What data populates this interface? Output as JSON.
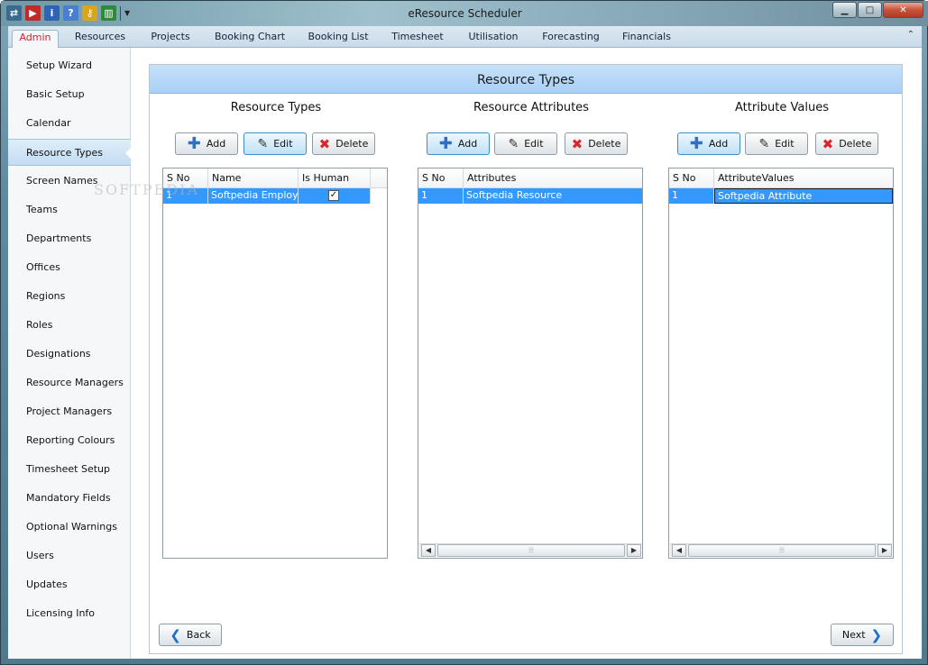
{
  "window": {
    "title": "eResource Scheduler"
  },
  "quick_access": {
    "icons": [
      "connect-icon",
      "exit-icon",
      "info-icon",
      "help-icon",
      "key-icon",
      "chart-icon"
    ]
  },
  "tabs": [
    {
      "label": "Admin",
      "active": true
    },
    {
      "label": "Resources"
    },
    {
      "label": "Projects"
    },
    {
      "label": "Booking Chart"
    },
    {
      "label": "Booking List"
    },
    {
      "label": "Timesheet"
    },
    {
      "label": "Utilisation"
    },
    {
      "label": "Forecasting"
    },
    {
      "label": "Financials"
    }
  ],
  "sidebar": {
    "active": "Resource Types",
    "items": [
      "Setup Wizard",
      "Basic Setup",
      "Calendar",
      "Resource Types",
      "Screen Names",
      "Teams",
      "Departments",
      "Offices",
      "Regions",
      "Roles",
      "Designations",
      "Resource Managers",
      "Project Managers",
      "Reporting Colours",
      "Timesheet Setup",
      "Mandatory Fields",
      "Optional Warnings",
      "Users",
      "Updates",
      "Licensing Info"
    ]
  },
  "panel": {
    "title": "Resource Types"
  },
  "buttons": {
    "add": "Add",
    "edit": "Edit",
    "delete": "Delete",
    "back": "Back",
    "next": "Next"
  },
  "sections": {
    "types": {
      "title": "Resource Types",
      "columns": [
        "S No",
        "Name",
        "Is Human"
      ],
      "rows": [
        {
          "sno": "1",
          "name": "Softpedia Employee",
          "is_human": true
        }
      ]
    },
    "attributes": {
      "title": "Resource Attributes",
      "columns": [
        "S No",
        "Attributes"
      ],
      "rows": [
        {
          "sno": "1",
          "value": "Softpedia Resource"
        }
      ]
    },
    "values": {
      "title": "Attribute Values",
      "columns": [
        "S No",
        "AttributeValues"
      ],
      "rows": [
        {
          "sno": "1",
          "value": "Softpedia Attribute"
        }
      ]
    }
  },
  "watermark": {
    "text": "SOFTPEDIA"
  },
  "colors": {
    "accent": "#3399ff",
    "header": "#a9d0f5",
    "active_tab": "#d8202b"
  }
}
